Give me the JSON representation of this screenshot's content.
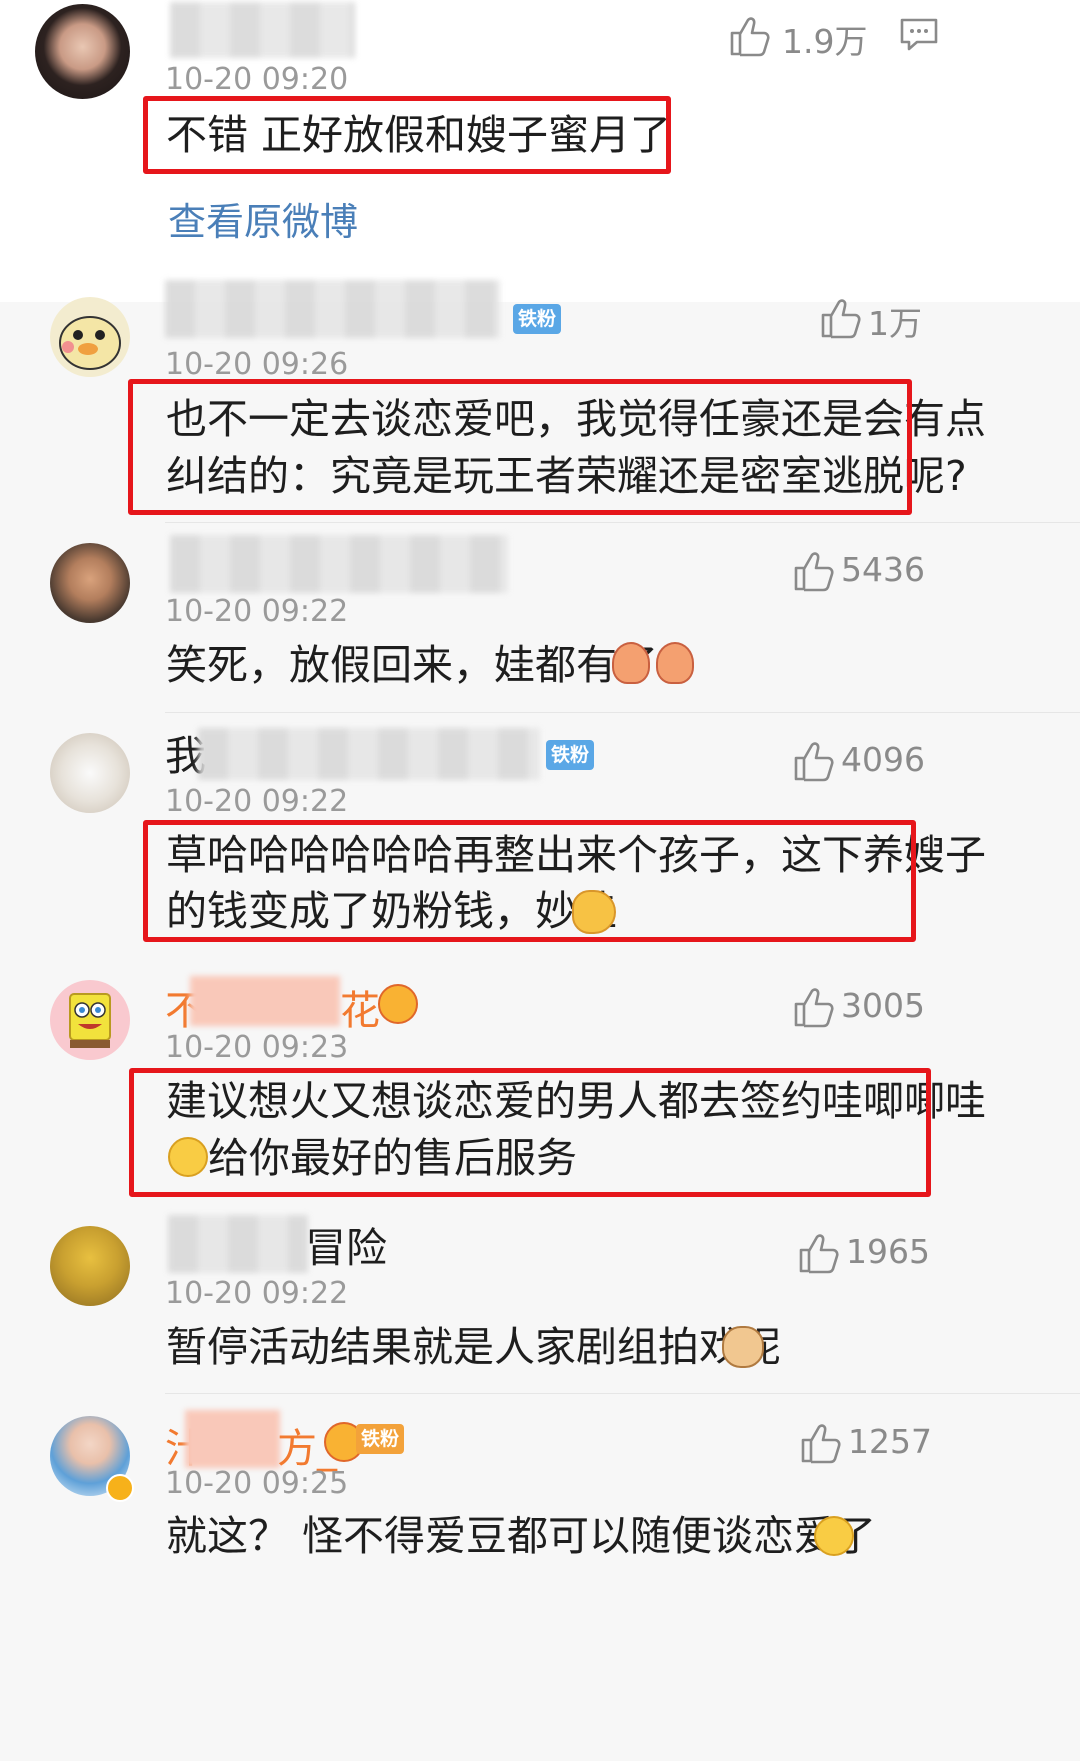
{
  "original": {
    "timestamp": "10-20 09:20",
    "likes": "1.9万",
    "text": "不错 正好放假和嫂子蜜月了",
    "view_link": "查看原微博"
  },
  "comments": [
    {
      "name_prefix": "",
      "name_suffix": "",
      "badge": "铁粉",
      "timestamp": "10-20 09:26",
      "likes": "1万",
      "line1": "也不一定去谈恋爱吧，我觉得任豪还是会有点",
      "line2": "纠结的：究竟是玩王者荣耀还是密室逃脱呢?"
    },
    {
      "timestamp": "10-20 09:22",
      "likes": "5436",
      "text": "笑死，放假回来，娃都有了"
    },
    {
      "name_prefix": "我",
      "badge": "铁粉",
      "timestamp": "10-20 09:22",
      "likes": "4096",
      "line1": "草哈哈哈哈哈哈再整出来个孩子，这下养嫂子",
      "line2": "的钱变成了奶粉钱，妙哇"
    },
    {
      "name_prefix": "不",
      "name_suffix": "花",
      "timestamp": "10-20 09:23",
      "likes": "3005",
      "line1": "建议想火又想谈恋爱的男人都去签约哇唧唧哇",
      "line2": "给你最好的售后服务"
    },
    {
      "name_suffix": "冒险",
      "timestamp": "10-20 09:22",
      "likes": "1965",
      "text": "暂停活动结果就是人家剧组拍戏呢"
    },
    {
      "name_prefix": "汁",
      "name_suffix": "方_",
      "badge": "铁粉",
      "timestamp": "10-20 09:25",
      "likes": "1257",
      "text": "就这？  怪不得爱豆都可以随便谈恋爱了"
    }
  ],
  "colors": {
    "red_box": "#e6161b",
    "link": "#4a7fb8",
    "badge": "#5aa7e6",
    "orange_name": "#f27a30"
  }
}
